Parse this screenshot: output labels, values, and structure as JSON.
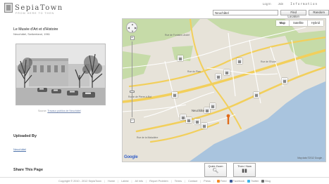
{
  "header": {
    "logo_text": "SepiaTown",
    "tagline": "FROM HERE TO THEN",
    "links": [
      "Log In",
      "Join",
      "Information"
    ]
  },
  "search": {
    "value": "Neuchâtel",
    "find_label": "Find Location",
    "random_label": "Random"
  },
  "place": {
    "title": "Le Musée d'Art et d'Histoire",
    "subtitle": "Neuchâtel, Switzerland, 1961",
    "caption_prefix": "Source: ",
    "caption_link": "Travaux publics de Neuchâtel"
  },
  "uploaded": {
    "heading": "Uploaded By",
    "user": "Neuchâtel"
  },
  "share": {
    "heading": "Share This Page"
  },
  "map": {
    "types": [
      "Map",
      "Satellite",
      "Hybrid"
    ],
    "active_type": "Map",
    "logo": "Google",
    "credit": "Map data ©2012 Google -",
    "road_labels": [
      "Rue de Fontaine-André",
      "Rue du Plan",
      "Rue de l'Evole",
      "Neuchâtel",
      "Route de Pierre-à-Bot",
      "Rue de la Maladière"
    ]
  },
  "actions": {
    "quick_zoom": "Quick Zoom",
    "then_now": "Then / Now"
  },
  "footer": {
    "copyright": "Copyright © 2010 - 2012 SepiaTown",
    "links": [
      "Home",
      "Latest",
      "All Info",
      "Report Problem",
      "Terms",
      "Contact",
      "Press"
    ],
    "social": [
      {
        "label": "Feed",
        "color": "#f28c28"
      },
      {
        "label": "Facebook",
        "color": "#3b5998"
      },
      {
        "label": "Twitter",
        "color": "#3fb5e8"
      },
      {
        "label": "Blog",
        "color": "#6b6b6b"
      }
    ]
  }
}
